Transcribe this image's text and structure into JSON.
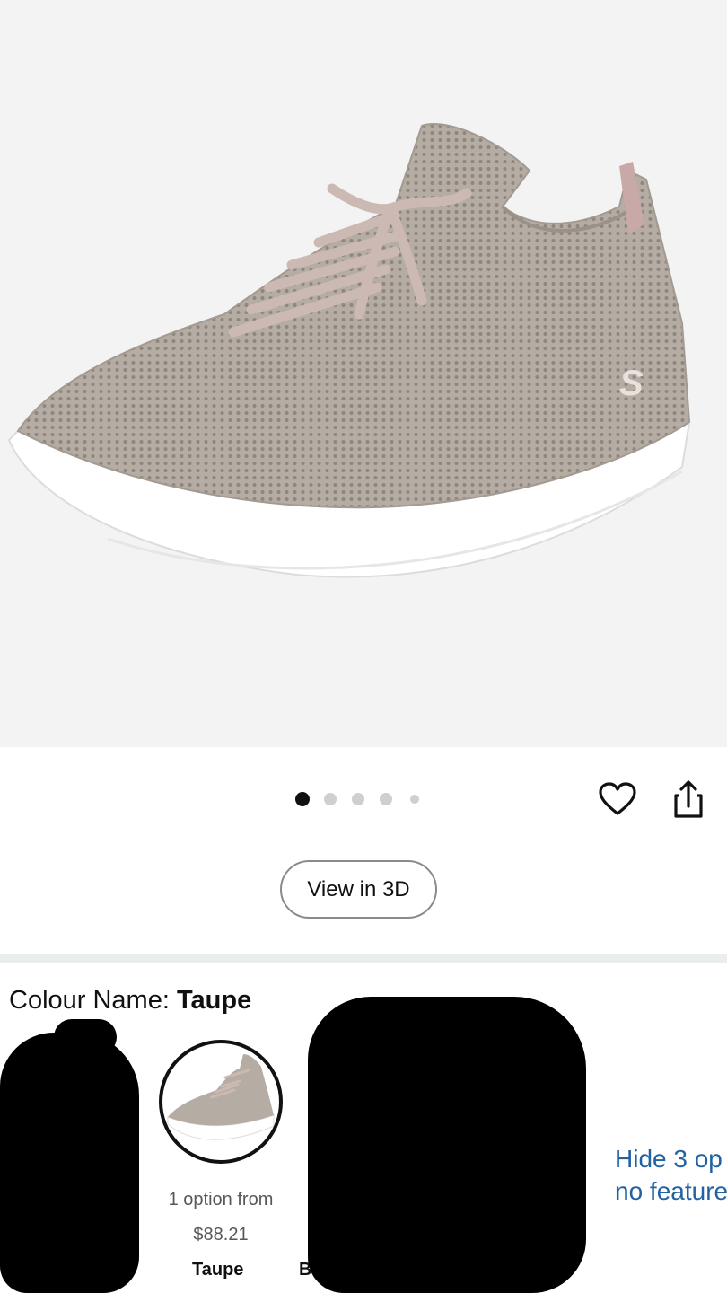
{
  "product_image": {
    "alt": "Taupe knit lace-up sneaker"
  },
  "carousel": {
    "count": 5,
    "active_index": 0
  },
  "actions": {
    "wishlist_icon": "heart-icon",
    "share_icon": "share-icon"
  },
  "view3d": {
    "label": "View in 3D"
  },
  "colour": {
    "label": "Colour Name:",
    "selected": "Taupe",
    "option": {
      "line1": "1 option from",
      "price": "$88.21",
      "name": "Taupe"
    },
    "next_name_partial": "B",
    "hide_link": {
      "line1": "Hide 3 op",
      "line2": "no feature"
    }
  },
  "colors": {
    "link": "#2162a1",
    "swatch_border": "#111111",
    "hero_bg": "#f3f3f3"
  }
}
